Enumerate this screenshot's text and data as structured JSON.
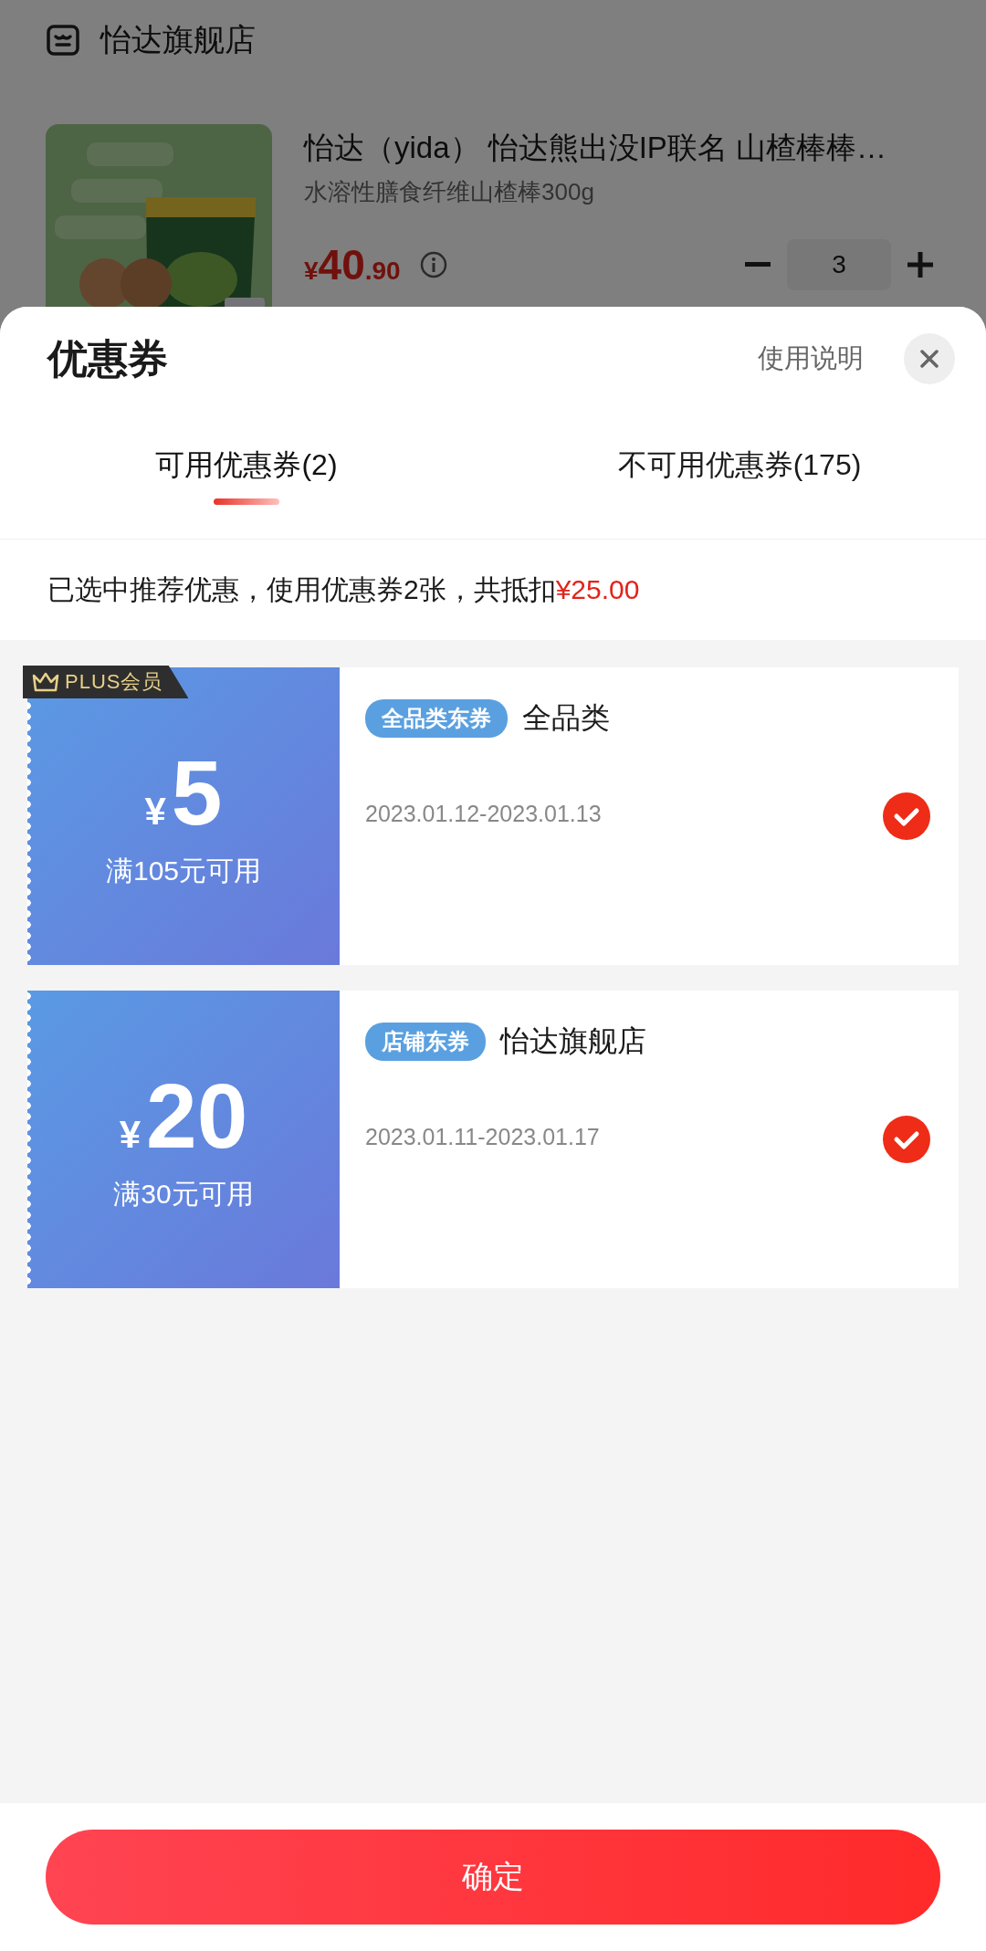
{
  "store": {
    "name": "怡达旗舰店"
  },
  "product": {
    "title": "怡达（yida） 怡达熊出没IP联名 山楂棒棒…",
    "spec": "水溶性膳食纤维山楂棒300g",
    "currency": "¥",
    "price_int": "40",
    "price_dec": ".90",
    "quantity": "3"
  },
  "sheet": {
    "title": "优惠券",
    "help": "使用说明"
  },
  "tabs": [
    {
      "label": "可用优惠券(2)",
      "selected": true
    },
    {
      "label": "不可用优惠券(175)",
      "selected": false
    }
  ],
  "summary": {
    "text": "已选中推荐优惠，使用优惠券2张，共抵扣",
    "amount": "¥25.00"
  },
  "coupons": [
    {
      "badge": "PLUS会员",
      "currency": "¥",
      "value": "5",
      "condition": "满105元可用",
      "tag": "全品类东券",
      "title": "全品类",
      "dates": "2023.01.12-2023.01.13",
      "checked": true
    },
    {
      "currency": "¥",
      "value": "20",
      "condition": "满30元可用",
      "tag": "店铺东券",
      "title": "怡达旗舰店",
      "dates": "2023.01.11-2023.01.17",
      "checked": true
    }
  ],
  "confirm": "确定"
}
